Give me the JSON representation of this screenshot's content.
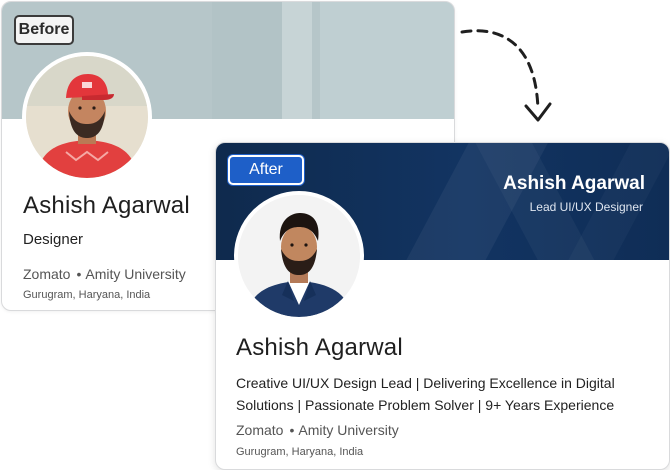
{
  "before": {
    "tag": "Before",
    "name": "Ashish Agarwal",
    "headline": "Designer",
    "company": "Zomato",
    "separator": "•",
    "school": "Amity University",
    "location": "Gurugram, Haryana, India"
  },
  "after": {
    "tag": "After",
    "banner_name": "Ashish Agarwal",
    "banner_role": "Lead UI/UX Designer",
    "name": "Ashish Agarwal",
    "headline": "Creative UI/UX Design Lead | Delivering Excellence in Digital Solutions | Passionate Problem Solver | 9+ Years Experience",
    "company": "Zomato",
    "separator": "•",
    "school": "Amity University",
    "location": "Gurugram, Haryana, India"
  },
  "colors": {
    "after_banner": "#123462",
    "after_tag": "#1e5fc8",
    "before_banner": "#b6c6c9"
  },
  "icons": [
    "dashed-curved-arrow-icon"
  ]
}
